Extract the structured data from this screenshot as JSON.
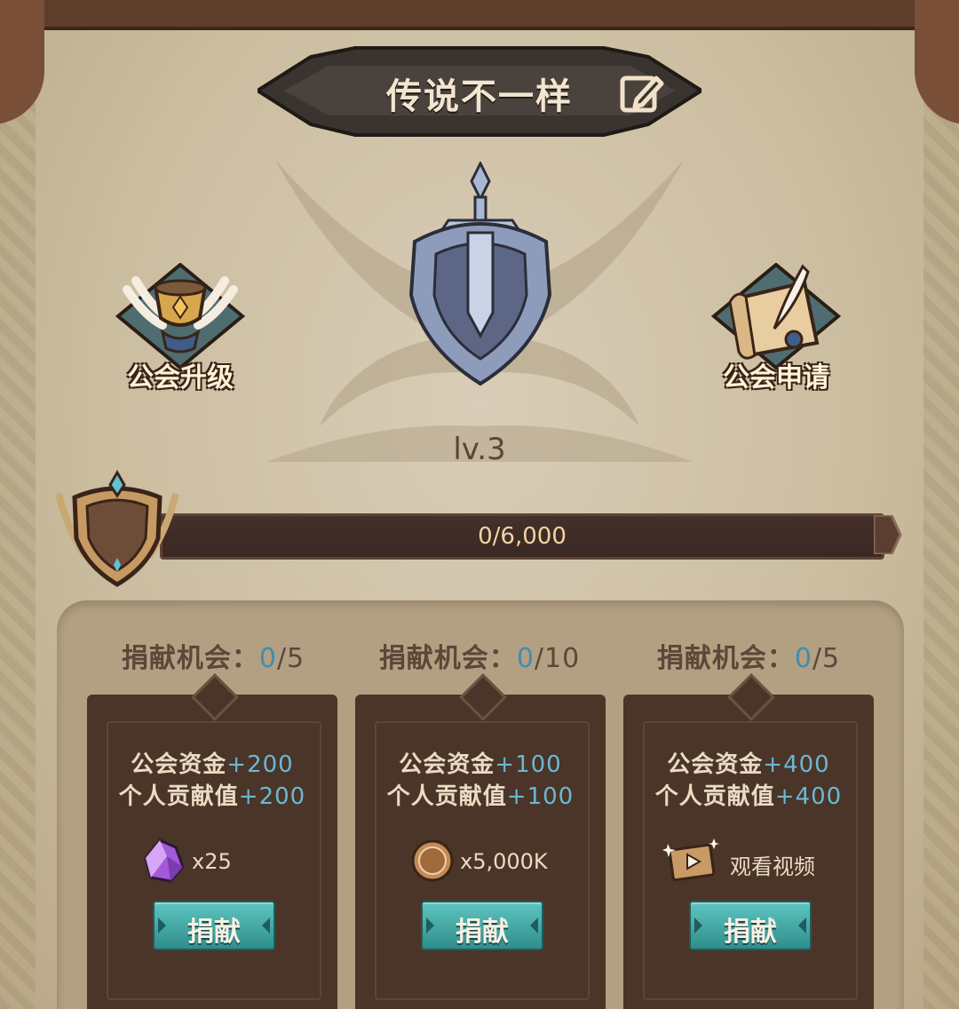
{
  "guild": {
    "name": "传说不一样",
    "level": "lv.3",
    "progress_text": "0/6,000",
    "progress_fraction": 0
  },
  "actions": {
    "upgrade_label": "公会升级",
    "apply_label": "公会申请"
  },
  "donations": [
    {
      "chance_label": "捐献机会：",
      "chance_current": "0",
      "chance_max": "/5",
      "fund_label": "公会资金",
      "fund_value": "+200",
      "contrib_label": "个人贡献值",
      "contrib_value": "+200",
      "cost_icon": "purple-crystal-icon",
      "cost_text": "x25",
      "button_label": "捐献"
    },
    {
      "chance_label": "捐献机会：",
      "chance_current": "0",
      "chance_max": "/10",
      "fund_label": "公会资金",
      "fund_value": "+100",
      "contrib_label": "个人贡献值",
      "contrib_value": "+100",
      "cost_icon": "gold-coin-icon",
      "cost_text": "x5,000K",
      "button_label": "捐献"
    },
    {
      "chance_label": "捐献机会：",
      "chance_current": "0",
      "chance_max": "/5",
      "fund_label": "公会资金",
      "fund_value": "+400",
      "contrib_label": "个人贡献值",
      "contrib_value": "+400",
      "cost_icon": "video-film-icon",
      "cost_text": "观看视频",
      "button_label": "捐献"
    }
  ],
  "colors": {
    "accent_blue": "#6bb7d3",
    "button_teal": "#3fa6a3",
    "panel_dark": "#4a3528"
  }
}
